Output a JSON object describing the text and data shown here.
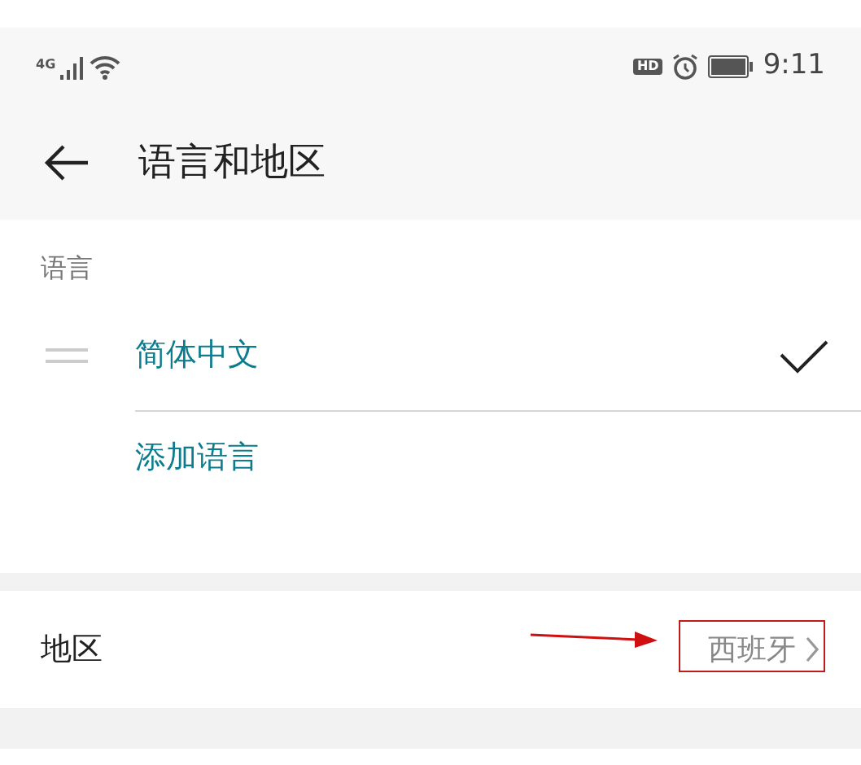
{
  "status_bar": {
    "network": "4G",
    "hd": "HD",
    "time": "9:11"
  },
  "header": {
    "title": "语言和地区"
  },
  "language_section": {
    "heading": "语言",
    "languages": [
      {
        "label": "简体中文",
        "selected": true
      }
    ],
    "add_label": "添加语言"
  },
  "region": {
    "label": "地区",
    "value": "西班牙"
  }
}
